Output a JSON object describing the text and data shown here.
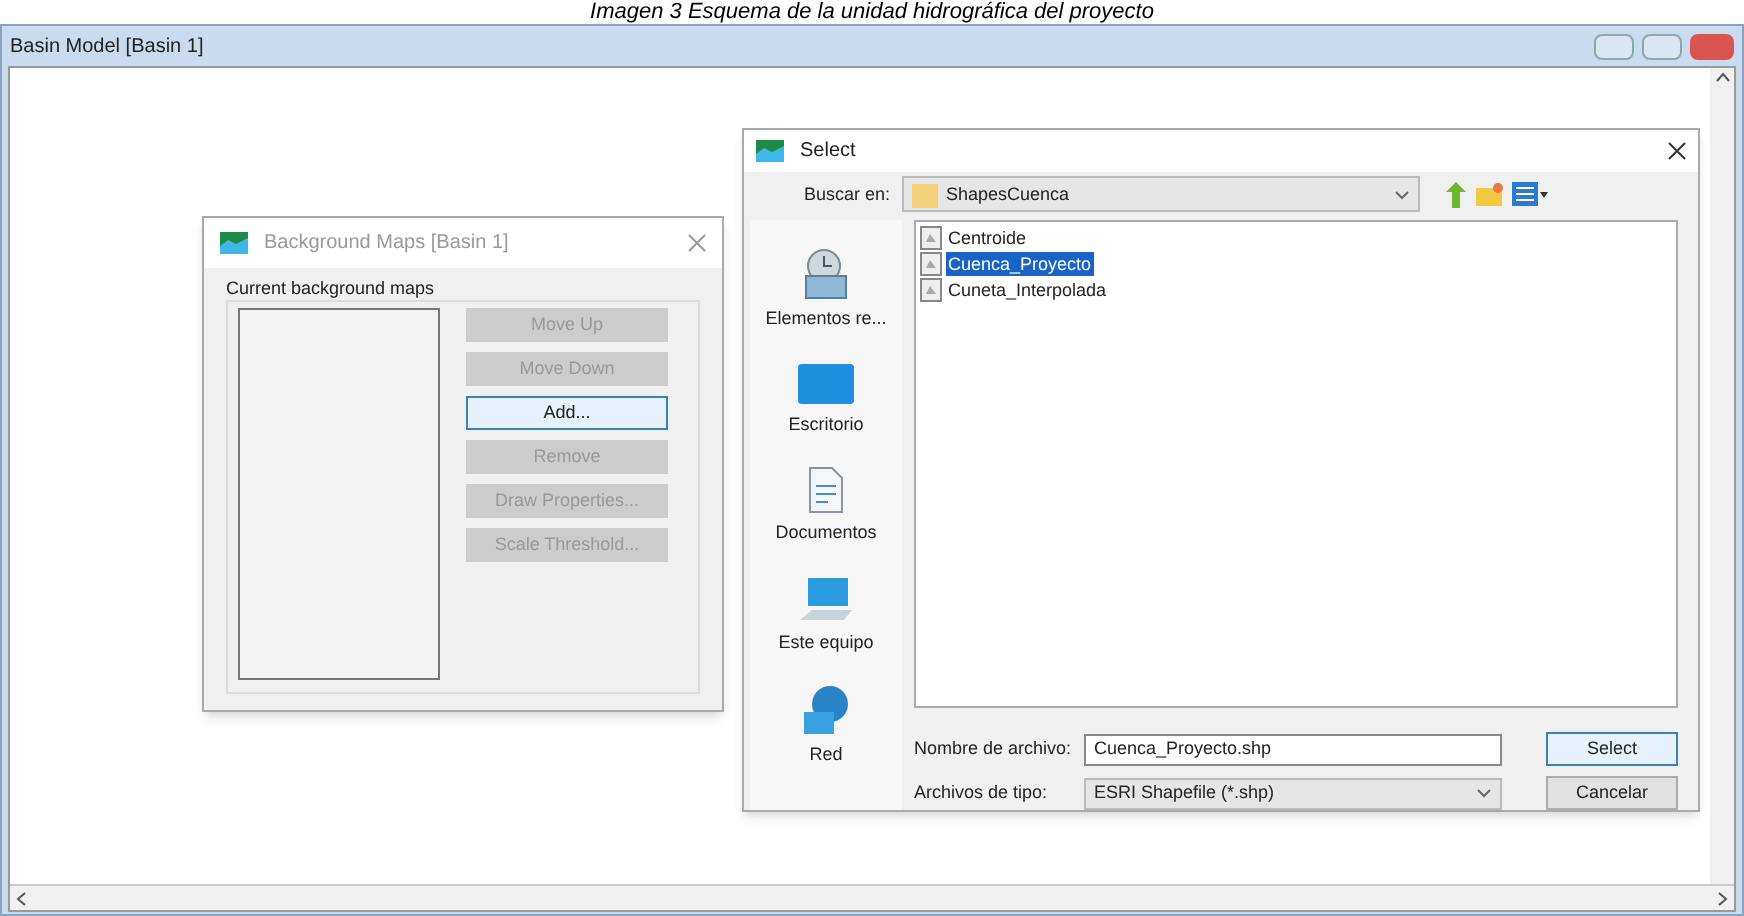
{
  "caption": "Imagen 3 Esquema de la unidad hidrográfica del proyecto",
  "window": {
    "title": "Basin Model [Basin 1]"
  },
  "background_maps_dialog": {
    "title": "Background Maps [Basin 1]",
    "group_label": "Current background maps",
    "buttons": [
      {
        "label": "Move Up",
        "disabled": true,
        "focused": false
      },
      {
        "label": "Move Down",
        "disabled": true,
        "focused": false
      },
      {
        "label": "Add...",
        "disabled": false,
        "focused": true
      },
      {
        "label": "Remove",
        "disabled": true,
        "focused": false
      },
      {
        "label": "Draw Properties...",
        "disabled": true,
        "focused": false
      },
      {
        "label": "Scale Threshold...",
        "disabled": true,
        "focused": false
      }
    ]
  },
  "select_dialog": {
    "title": "Select",
    "look_in_label": "Buscar en:",
    "look_in_value": "ShapesCuenca",
    "places": [
      {
        "label": "Elementos re...",
        "kind": "recent"
      },
      {
        "label": "Escritorio",
        "kind": "desktop"
      },
      {
        "label": "Documentos",
        "kind": "documents"
      },
      {
        "label": "Este equipo",
        "kind": "computer"
      },
      {
        "label": "Red",
        "kind": "network"
      }
    ],
    "files": [
      {
        "name": "Centroide",
        "selected": false
      },
      {
        "name": "Cuenca_Proyecto",
        "selected": true
      },
      {
        "name": "Cuneta_Interpolada",
        "selected": false
      }
    ],
    "file_name_label": "Nombre de archivo:",
    "file_name_value": "Cuenca_Proyecto.shp",
    "file_type_label": "Archivos de tipo:",
    "file_type_value": "ESRI Shapefile (*.shp)",
    "buttons": [
      {
        "label": "Select",
        "default": true
      },
      {
        "label": "Cancelar",
        "default": false
      }
    ]
  }
}
